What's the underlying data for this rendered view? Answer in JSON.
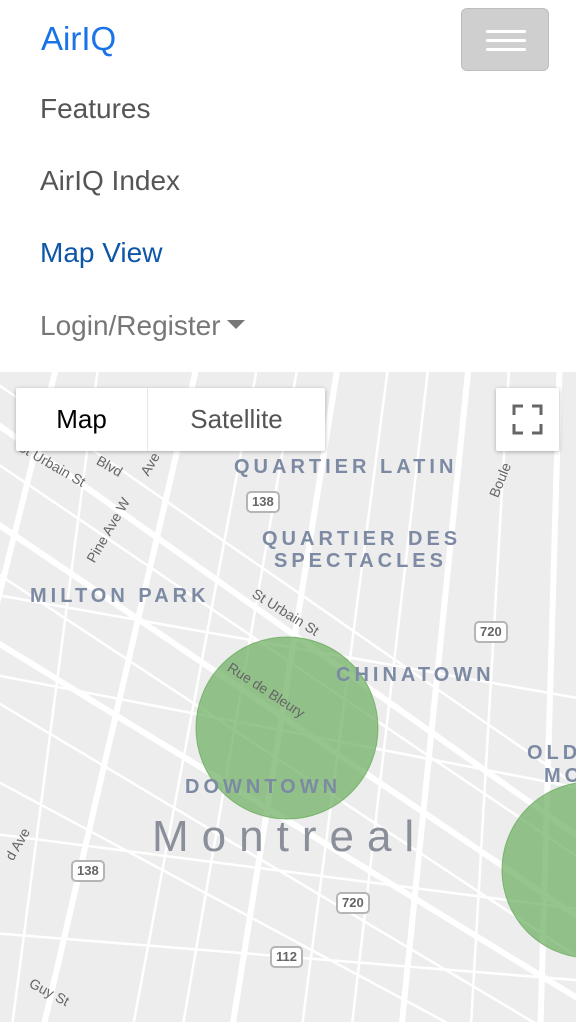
{
  "navbar": {
    "brand": "AirIQ",
    "toggler_icon": "hamburger-menu-icon",
    "links": [
      "Features",
      "AirIQ Index",
      "Map View"
    ],
    "active_link": "Map View",
    "dropdown_label": "Login/Register"
  },
  "map": {
    "controls": {
      "map_label": "Map",
      "satellite_label": "Satellite",
      "fullscreen_icon": "fullscreen-icon",
      "selected": "Map"
    },
    "city_label": "Montreal",
    "area_labels": {
      "quartier_latin": "QUARTIER LATIN",
      "quartier_des_1": "QUARTIER DES",
      "quartier_des_2": "SPECTACLES",
      "milton_park": "MILTON PARK",
      "chinatown": "CHINATOWN",
      "downtown": "DOWNTOWN",
      "old_1": "OLD",
      "old_2": "MO"
    },
    "street_labels": {
      "st_urbain_1": "St Urbain St",
      "st_urbain_2": "St Urbain St",
      "pine_ave": "Pine Ave W",
      "rue_de_bleury": "Rue de Bleury",
      "guy_st": "Guy St",
      "blvd": "Blvd",
      "ave": "Ave",
      "park_ave": "d Ave",
      "boule": "Boule"
    },
    "highway_shields": {
      "h138_top": "138",
      "h720_right": "720",
      "h138_bottom": "138",
      "h720_bottom": "720",
      "h112": "112"
    },
    "air_quality_zone_color": "#6aad5e"
  }
}
